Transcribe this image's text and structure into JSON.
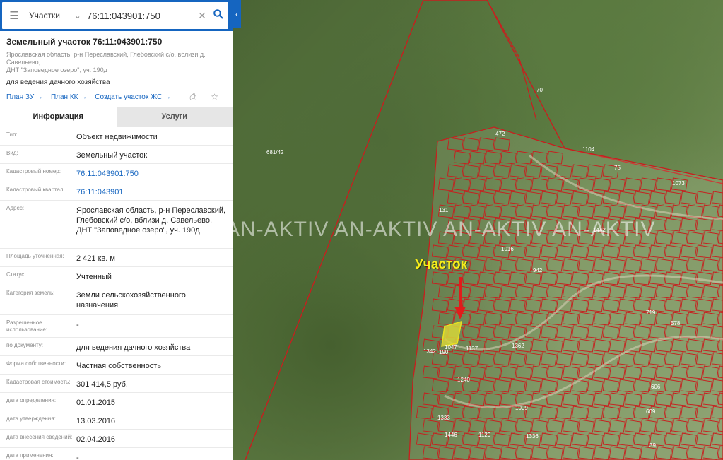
{
  "search": {
    "layer": "Участки",
    "query": "76:11:043901:750"
  },
  "parcel": {
    "title": "Земельный участок 76:11:043901:750",
    "address_line1": "Ярославская область, р-н Переславский, Глебовский с/о, вблизи д. Савельево,",
    "address_line2": "ДНТ \"Заповедное озеро\", уч. 190д",
    "purpose": "для ведения дачного хозяйства"
  },
  "links": {
    "plan_zu": "План ЗУ →",
    "plan_kk": "План КК →",
    "create_plot": "Создать участок ЖС →"
  },
  "tabs": {
    "info": "Информация",
    "services": "Услуги"
  },
  "info": [
    {
      "label": "Тип:",
      "value": "Объект недвижимости"
    },
    {
      "label": "Вид:",
      "value": "Земельный участок"
    },
    {
      "label": "Кадастровый номер:",
      "value": "76:11:043901:750",
      "link": true
    },
    {
      "label": "Кадастровый квартал:",
      "value": "76:11:043901",
      "link": true
    },
    {
      "label": "Адрес:",
      "value": "Ярославская область, р-н Переславский, Глебовский с/о, вблизи д. Савельево, ДНТ \"Заповедное озеро\", уч. 190д"
    },
    {
      "label": "Площадь уточненная:",
      "value": "2 421 кв. м"
    },
    {
      "label": "Статус:",
      "value": "Учтенный"
    },
    {
      "label": "Категория земель:",
      "value": "Земли сельскохозяйственного назначения"
    },
    {
      "label": "Разрешенное использование:",
      "value": "-"
    },
    {
      "label": "по документу:",
      "value": "для ведения дачного хозяйства"
    },
    {
      "label": "Форма собственности:",
      "value": "Частная собственность"
    },
    {
      "label": "Кадастровая стоимость:",
      "value": "301 414,5 руб."
    },
    {
      "label": "дата определения:",
      "value": "01.01.2015"
    },
    {
      "label": "дата утверждения:",
      "value": "13.03.2016"
    },
    {
      "label": "дата внесения сведений:",
      "value": "02.04.2016"
    },
    {
      "label": "дата применения:",
      "value": "-"
    }
  ],
  "map": {
    "watermark": "AN-AKTIV  AN-AKTIV  AN-AKTIV  AN-AKTIV",
    "plot_label": "Участок",
    "plot_numbers": [
      "681/42",
      "70",
      "472",
      "1104",
      "75",
      "1073",
      "131",
      "1442",
      "190",
      "1047",
      "1342",
      "1137",
      "1362",
      "1240",
      "1333",
      "1446",
      "1129",
      "1336",
      "1009",
      "606",
      "609",
      "39",
      "719",
      "1016",
      "942",
      "578"
    ],
    "colors": {
      "boundary": "#c81e1e",
      "accent": "#1565c0",
      "highlight": "#f7ee1a",
      "arrow": "#e21b1b"
    }
  }
}
